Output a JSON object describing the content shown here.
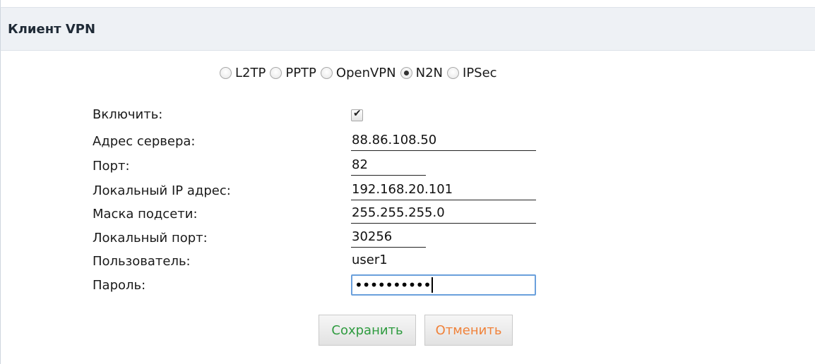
{
  "header": {
    "title": "Клиент VPN"
  },
  "vpn_types": [
    {
      "label": "L2TP",
      "checked": false
    },
    {
      "label": "PPTP",
      "checked": false
    },
    {
      "label": "OpenVPN",
      "checked": false
    },
    {
      "label": "N2N",
      "checked": true
    },
    {
      "label": "IPSec",
      "checked": false
    }
  ],
  "form": {
    "enable_label": "Включить:",
    "enable_checked": true,
    "server_label": "Адрес сервера:",
    "server_value": "88.86.108.50",
    "port_label": "Порт:",
    "port_value": "82",
    "local_ip_label": "Локальный IP адрес:",
    "local_ip_value": "192.168.20.101",
    "mask_label": "Маска подсети:",
    "mask_value": "255.255.255.0",
    "local_port_label": "Локальный порт:",
    "local_port_value": "30256",
    "user_label": "Пользователь:",
    "user_value": "user1",
    "password_label": "Пароль:",
    "password_value": "••••••••••"
  },
  "buttons": {
    "save": "Сохранить",
    "cancel": "Отменить"
  },
  "colors": {
    "save_text": "#2e9b3f",
    "cancel_text": "#f0823a",
    "focus_border": "#6aa0dc",
    "header_bg": "#eef1f5"
  }
}
